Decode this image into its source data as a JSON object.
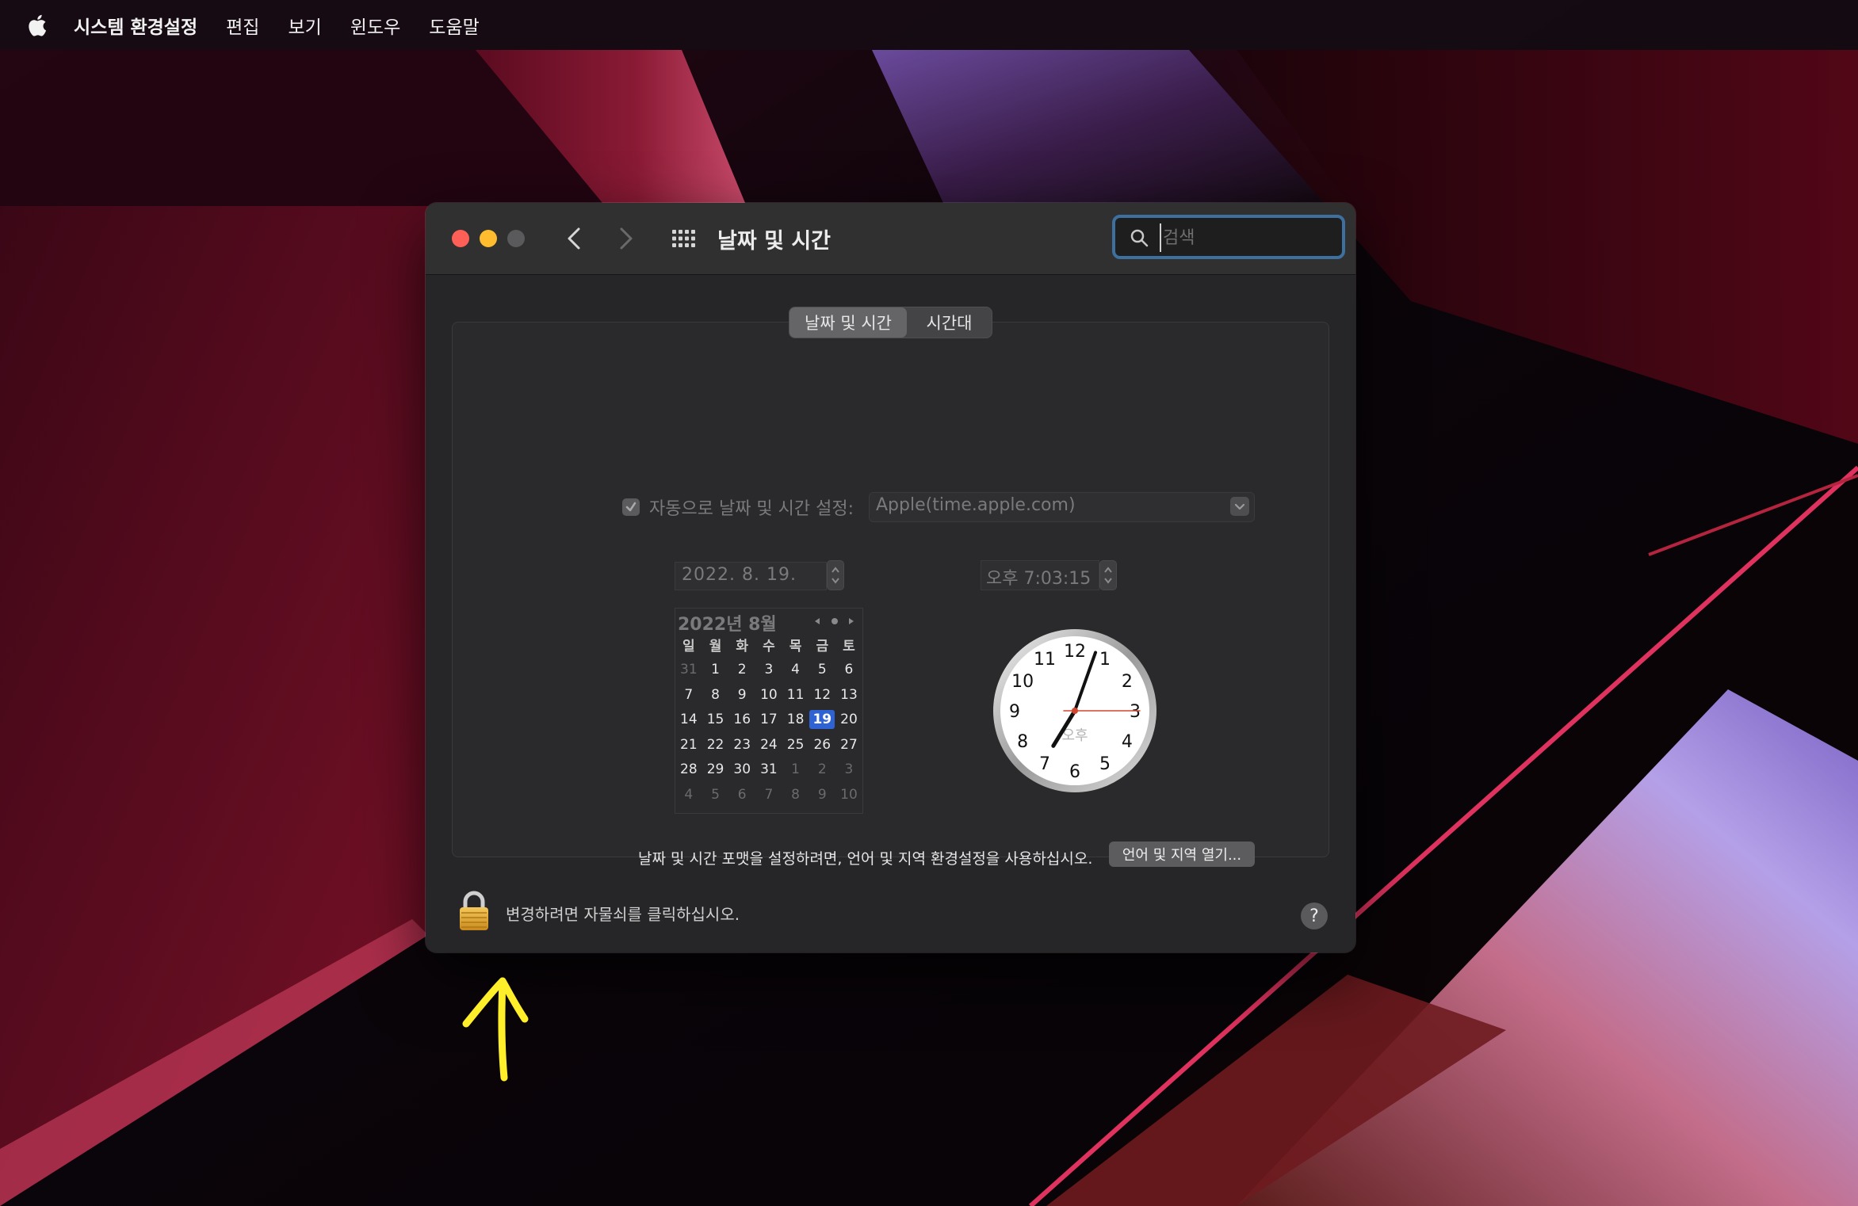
{
  "menubar": {
    "apple_icon": "apple-logo-icon",
    "app_name": "시스템 환경설정",
    "items": [
      "편집",
      "보기",
      "윈도우",
      "도움말"
    ]
  },
  "window": {
    "title": "날짜 및 시간",
    "search": {
      "placeholder": "검색",
      "value": ""
    },
    "tabs": [
      {
        "label": "날짜 및 시간",
        "selected": true
      },
      {
        "label": "시간대",
        "selected": false
      }
    ],
    "auto_set": {
      "checked": true,
      "label": "자동으로 날짜 및 시간 설정:",
      "server": "Apple(time.apple.com)"
    },
    "date_field": "2022.  8. 19.",
    "time_field": "오후   7:03:15",
    "calendar": {
      "title": "2022년 8월",
      "weekdays": [
        "일",
        "월",
        "화",
        "수",
        "목",
        "금",
        "토"
      ],
      "weeks": [
        [
          "31",
          "1",
          "2",
          "3",
          "4",
          "5",
          "6"
        ],
        [
          "7",
          "8",
          "9",
          "10",
          "11",
          "12",
          "13"
        ],
        [
          "14",
          "15",
          "16",
          "17",
          "18",
          "19",
          "20"
        ],
        [
          "21",
          "22",
          "23",
          "24",
          "25",
          "26",
          "27"
        ],
        [
          "28",
          "29",
          "30",
          "31",
          "1",
          "2",
          "3"
        ],
        [
          "4",
          "5",
          "6",
          "7",
          "8",
          "9",
          "10"
        ]
      ],
      "selected_day": "19"
    },
    "clock": {
      "numbers": [
        "12",
        "1",
        "2",
        "3",
        "4",
        "5",
        "6",
        "7",
        "8",
        "9",
        "10",
        "11"
      ],
      "am_pm_label": "오후",
      "hours": 7,
      "minutes": 3,
      "seconds": 15
    },
    "format_note": "날짜 및 시간 포맷을 설정하려면, 언어 및 지역 환경설정을 사용하십시오.",
    "open_language_button": "언어 및 지역 열기...",
    "lock_text": "변경하려면 자물쇠를 클릭하십시오.",
    "help_label": "?"
  },
  "colors": {
    "accent_blue": "#2f63d3",
    "annotation_yellow": "#ffef2a",
    "close": "#fe5f57",
    "minimize": "#febc2e"
  }
}
